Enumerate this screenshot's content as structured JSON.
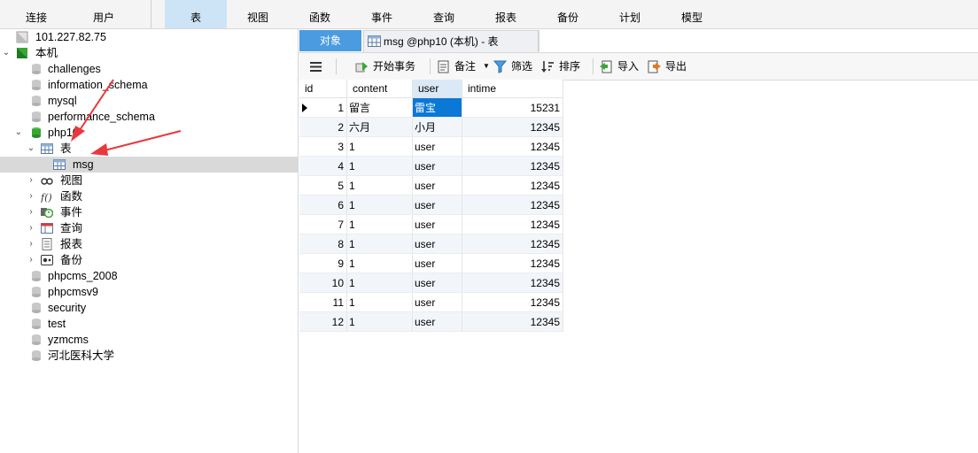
{
  "toolbar": {
    "items": [
      {
        "label": "连接"
      },
      {
        "label": "用户"
      },
      {
        "label": "表"
      },
      {
        "label": "视图"
      },
      {
        "label": "函数"
      },
      {
        "label": "事件"
      },
      {
        "label": "查询"
      },
      {
        "label": "报表"
      },
      {
        "label": "备份"
      },
      {
        "label": "计划"
      },
      {
        "label": "模型"
      }
    ],
    "active_item": "表"
  },
  "sidebar": {
    "connection": "101.227.82.75",
    "local": "本机",
    "databases_top": [
      "challenges",
      "information_schema",
      "mysql",
      "performance_schema"
    ],
    "open_db": "php10",
    "tables_label": "表",
    "table_msg": "msg",
    "objects": [
      "视图",
      "函数",
      "事件",
      "查询",
      "报表",
      "备份"
    ],
    "databases_bottom": [
      "phpcms_2008",
      "phpcmsv9",
      "security",
      "test",
      "yzmcms",
      "河北医科大学"
    ]
  },
  "tabs": {
    "objects_label": "对象",
    "msg_label": "msg @php10 (本机) - 表"
  },
  "object_toolbar": {
    "begin_transaction": "开始事务",
    "memo": "备注",
    "filter": "筛选",
    "sort": "排序",
    "import": "导入",
    "export": "导出"
  },
  "grid": {
    "columns": [
      "id",
      "content",
      "user",
      "intime"
    ],
    "rows": [
      {
        "id": "1",
        "content": "留言",
        "user": "雷宝",
        "intime": "15231"
      },
      {
        "id": "2",
        "content": "六月",
        "user": "小月",
        "intime": "12345"
      },
      {
        "id": "3",
        "content": "1",
        "user": "user",
        "intime": "12345"
      },
      {
        "id": "4",
        "content": "1",
        "user": "user",
        "intime": "12345"
      },
      {
        "id": "5",
        "content": "1",
        "user": "user",
        "intime": "12345"
      },
      {
        "id": "6",
        "content": "1",
        "user": "user",
        "intime": "12345"
      },
      {
        "id": "7",
        "content": "1",
        "user": "user",
        "intime": "12345"
      },
      {
        "id": "8",
        "content": "1",
        "user": "user",
        "intime": "12345"
      },
      {
        "id": "9",
        "content": "1",
        "user": "user",
        "intime": "12345"
      },
      {
        "id": "10",
        "content": "1",
        "user": "user",
        "intime": "12345"
      },
      {
        "id": "11",
        "content": "1",
        "user": "user",
        "intime": "12345"
      },
      {
        "id": "12",
        "content": "1",
        "user": "user",
        "intime": "12345"
      }
    ]
  },
  "colors": {
    "accent_tab": "#4a9be0",
    "selection": "#0a78d6",
    "annotation_arrow": "#e8383d",
    "db_icon": "#b0b0b0",
    "db_icon_open": "#3aa635"
  }
}
